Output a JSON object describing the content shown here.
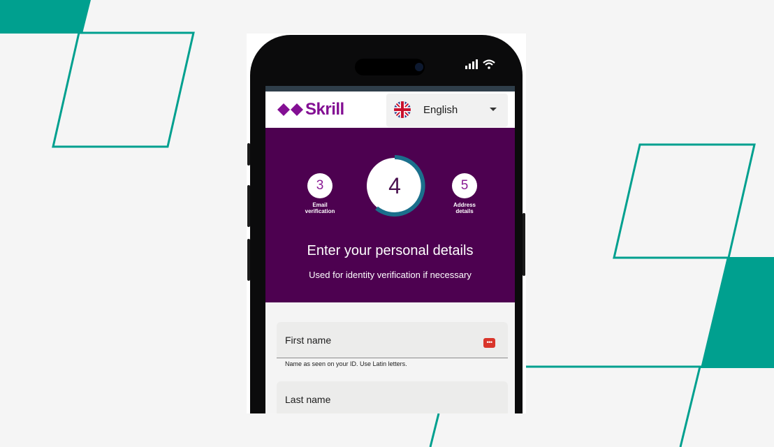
{
  "app": {
    "logo_text": "Skrill",
    "brand_color": "#830f93",
    "band_color": "#4d0150",
    "accent_color": "#00a08f"
  },
  "language": {
    "selected": "English",
    "flag_icon": "uk-flag-icon"
  },
  "steps": {
    "previous": {
      "number": "3",
      "caption_line1": "Email",
      "caption_line2": "verification"
    },
    "current": {
      "number": "4"
    },
    "next": {
      "number": "5",
      "caption_line1": "Address",
      "caption_line2": "details"
    }
  },
  "heading": {
    "title": "Enter your personal details",
    "subtitle": "Used for identity verification if necessary"
  },
  "form": {
    "first_name": {
      "label": "First name",
      "hint": "Name as seen on your ID. Use Latin letters.",
      "autofill_icon": "password-manager-icon"
    },
    "last_name": {
      "label": "Last name"
    }
  }
}
